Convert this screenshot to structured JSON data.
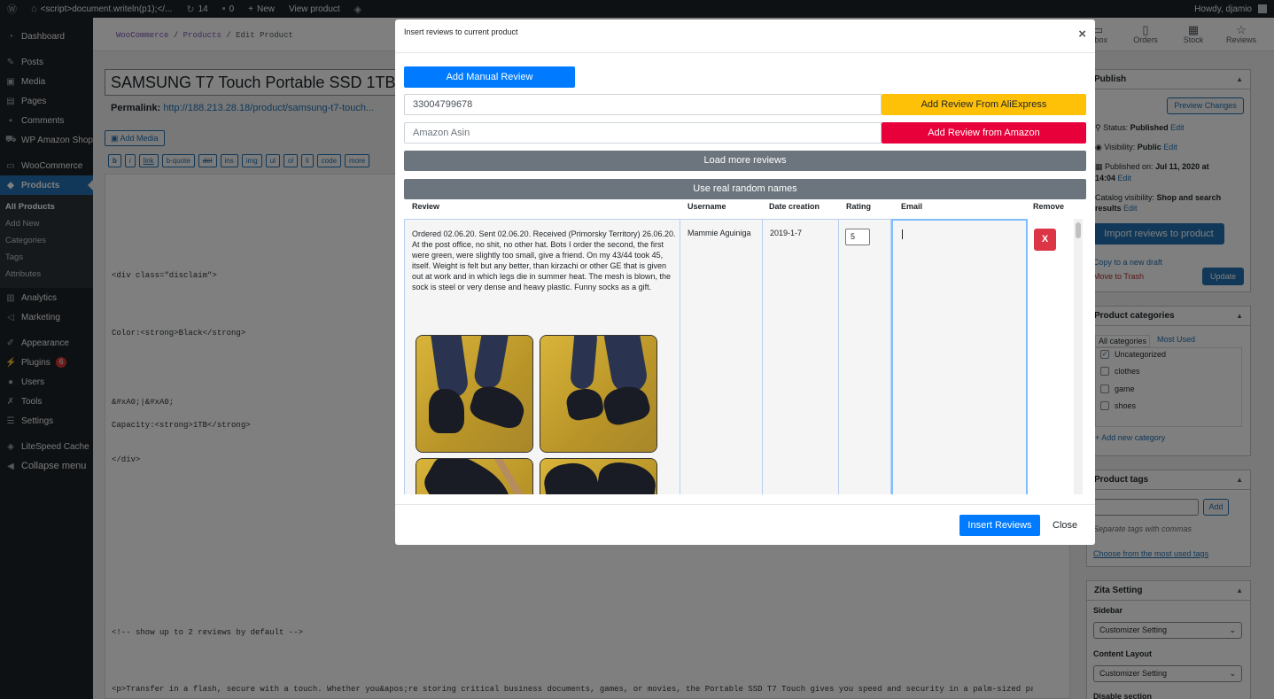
{
  "adminbar": {
    "site_title": "<script>document.writeln(p1);</...",
    "updates_count": "14",
    "comments_count": "0",
    "new_label": "New",
    "view_product": "View product",
    "howdy": "Howdy, djamio"
  },
  "sidebar": {
    "items": [
      {
        "label": "Dashboard",
        "icon": "dashboard-icon"
      },
      {
        "label": "Posts",
        "icon": "pin-icon"
      },
      {
        "label": "Media",
        "icon": "media-icon"
      },
      {
        "label": "Pages",
        "icon": "pages-icon"
      },
      {
        "label": "Comments",
        "icon": "comment-icon"
      },
      {
        "label": "WP Amazon Shop",
        "icon": "cart-icon"
      },
      {
        "label": "WooCommerce",
        "icon": "woo-icon"
      },
      {
        "label": "Products",
        "icon": "box-icon"
      }
    ],
    "submenu": [
      "All Products",
      "Add New",
      "Categories",
      "Tags",
      "Attributes"
    ],
    "items2": [
      {
        "label": "Analytics",
        "icon": "chart-icon"
      },
      {
        "label": "Marketing",
        "icon": "megaphone-icon"
      },
      {
        "label": "Appearance",
        "icon": "brush-icon"
      },
      {
        "label": "Plugins",
        "icon": "plug-icon",
        "badge": "6"
      },
      {
        "label": "Users",
        "icon": "user-icon"
      },
      {
        "label": "Tools",
        "icon": "wrench-icon"
      },
      {
        "label": "Settings",
        "icon": "settings-icon"
      },
      {
        "label": "LiteSpeed Cache",
        "icon": "diamond-icon"
      },
      {
        "label": "Collapse menu",
        "icon": "collapse-icon"
      }
    ]
  },
  "wc_header": {
    "breadcrumb": [
      "WooCommerce",
      "Products",
      "Edit Product"
    ],
    "nav": [
      "Inbox",
      "Orders",
      "Stock",
      "Reviews"
    ]
  },
  "editor": {
    "title": "SAMSUNG T7 Touch Portable SSD 1TB",
    "permalink_label": "Permalink:",
    "permalink_url": "http://188.213.28.18/product/samsung-t7-touch...",
    "add_media": "Add Media",
    "quicktags": [
      "b",
      "i",
      "link",
      "b-quote",
      "del",
      "ins",
      "img",
      "ul",
      "ol",
      "li",
      "code",
      "more"
    ],
    "code_lines": [
      "<div class=\"disclaim\">",
      "Color:<strong>Black</strong>",
      "&#xA0;|&#xA0;",
      "Capacity:<strong>1TB</strong>",
      "</div>",
      "<!-- show up to 2 reviews by default -->",
      "<p>Transfer in a flash, secure with a touch. Whether you&apos;re storing critical business documents, games, or movies, the Portable SSD T7 Touch gives you speed and security in a palm-sized package."
    ]
  },
  "publish": {
    "title": "Publish",
    "preview": "Preview Changes",
    "status_label": "Status:",
    "status_value": "Published",
    "visibility_label": "Visibility:",
    "visibility_value": "Public",
    "published_label": "Published on:",
    "published_value": "Jul 11, 2020 at",
    "published_time": "14:04",
    "catalog_label": "Catalog visibility:",
    "catalog_value": "Shop and search",
    "catalog_value2": "results",
    "edit": "Edit",
    "import_btn": "Import reviews to product",
    "copy_draft": "Copy to a new draft",
    "trash": "Move to Trash",
    "update": "Update"
  },
  "categories": {
    "title": "Product categories",
    "tab_all": "All categories",
    "tab_used": "Most Used",
    "items": [
      {
        "label": "Uncategorized",
        "checked": true
      },
      {
        "label": "clothes",
        "checked": false
      },
      {
        "label": "game",
        "checked": false
      },
      {
        "label": "shoes",
        "checked": false
      }
    ],
    "add_new": "+ Add new category"
  },
  "tags": {
    "title": "Product tags",
    "add": "Add",
    "hint": "Separate tags with commas",
    "choose": "Choose from the most used tags"
  },
  "zita": {
    "title": "Zita Setting",
    "sidebar_label": "Sidebar",
    "sidebar_value": "Customizer Setting",
    "layout_label": "Content Layout",
    "layout_value": "Customizer Setting",
    "disable_label": "Disable section"
  },
  "modal": {
    "title": "Insert reviews to current product",
    "close_x": "×",
    "add_manual": "Add Manual Review",
    "aliexpress_value": "33004799678",
    "amazon_placeholder": "Amazon Asin",
    "add_aliexpress": "Add Review From AliExpress",
    "add_amazon": "Add Review from Amazon",
    "load_more": "Load more reviews",
    "random_names": "Use real random names",
    "columns": [
      "Review",
      "Username",
      "Date creation",
      "Rating",
      "Email",
      "Remove"
    ],
    "row": {
      "review": "Ordered 02.06.20. Sent 02.06.20. Received (Primorsky Territory) 26.06.20. At the post office, no shit, no other hat. Bots I order the second, the first were green, were slightly too small, give a friend. On my 43/44 took 45, itself. Weight is felt but any better, than kirzachi or other GE that is given out at work and in which legs die in summer heat. The mesh is blown, the sock is steel or very dense and heavy plastic. Funny socks as a gift.",
      "username": "Mammie Aguiniga",
      "date": "2019-1-7",
      "rating": "5",
      "email": "",
      "remove": "X"
    },
    "insert": "Insert Reviews",
    "close": "Close"
  },
  "colors": {
    "wp_blue": "#2271b1",
    "bootstrap_primary": "#007bff",
    "aliexpress_yellow": "#ffc107",
    "amazon_red": "#e8003a",
    "secondary_gray": "#6c757d",
    "danger": "#dc3545"
  }
}
